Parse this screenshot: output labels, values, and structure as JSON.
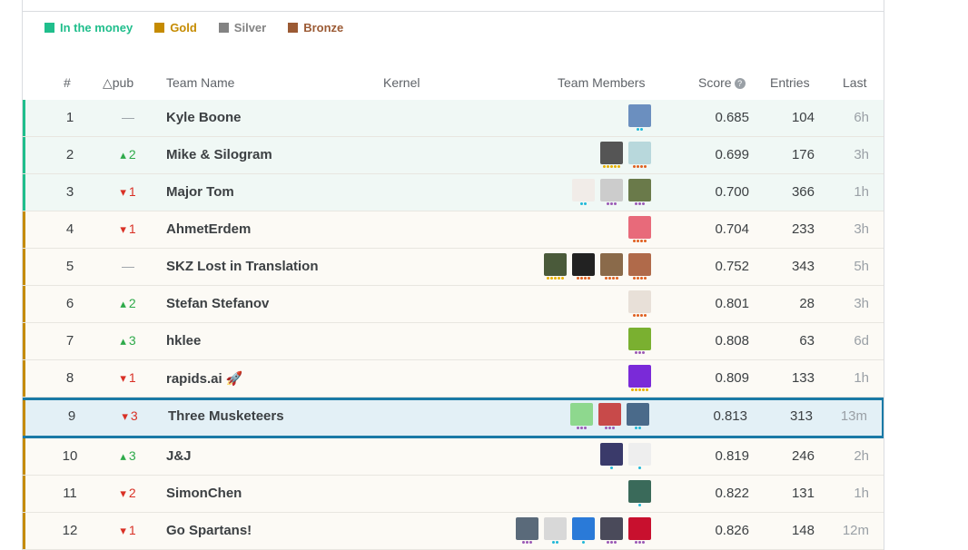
{
  "legend": [
    {
      "label": "In the money",
      "color": "#20be8c"
    },
    {
      "label": "Gold",
      "color": "#c58b00"
    },
    {
      "label": "Silver",
      "color": "#838383"
    },
    {
      "label": "Bronze",
      "color": "#9b5a34"
    }
  ],
  "columns": {
    "rank": "#",
    "delta": "△pub",
    "team": "Team Name",
    "kernel": "Kernel",
    "members": "Team Members",
    "score": "Score",
    "entries": "Entries",
    "last": "Last"
  },
  "rows": [
    {
      "rank": "1",
      "delta": "—",
      "team": "Kyle Boone",
      "score": "0.685",
      "entries": "104",
      "last": "6h",
      "tier": "money",
      "members": [
        {
          "color": "#6b8fbf",
          "dots": "#20b8d8",
          "n": 2
        }
      ]
    },
    {
      "rank": "2",
      "delta": "2",
      "dir": "up",
      "team": "Mike & Silogram",
      "score": "0.699",
      "entries": "176",
      "last": "3h",
      "tier": "money",
      "members": [
        {
          "color": "#555555",
          "dots": "#e8b000",
          "n": 5
        },
        {
          "color": "#b8d8dc",
          "dots": "#e06020",
          "n": 4
        }
      ]
    },
    {
      "rank": "3",
      "delta": "1",
      "dir": "down",
      "team": "Major Tom",
      "score": "0.700",
      "entries": "366",
      "last": "1h",
      "tier": "money",
      "members": [
        {
          "color": "#f1ece8",
          "dots": "#20b8d8",
          "n": 2
        },
        {
          "color": "#cccccc",
          "dots": "#9b59b6",
          "n": 3
        },
        {
          "color": "#6a7a4a",
          "dots": "#9b59b6",
          "n": 3
        }
      ]
    },
    {
      "rank": "4",
      "delta": "1",
      "dir": "down",
      "team": "AhmetErdem",
      "score": "0.704",
      "entries": "233",
      "last": "3h",
      "tier": "gold",
      "members": [
        {
          "color": "#e86a7a",
          "dots": "#e06020",
          "n": 4
        }
      ]
    },
    {
      "rank": "5",
      "delta": "—",
      "team": "SKZ Lost in Translation",
      "score": "0.752",
      "entries": "343",
      "last": "5h",
      "tier": "gold",
      "members": [
        {
          "color": "#4a5a3a",
          "dots": "#e8b000",
          "n": 5
        },
        {
          "color": "#222222",
          "dots": "#e06020",
          "n": 4
        },
        {
          "color": "#8a6a4a",
          "dots": "#e06020",
          "n": 4
        },
        {
          "color": "#b06a4a",
          "dots": "#e06020",
          "n": 4
        }
      ]
    },
    {
      "rank": "6",
      "delta": "2",
      "dir": "up",
      "team": "Stefan Stefanov",
      "score": "0.801",
      "entries": "28",
      "last": "3h",
      "tier": "gold",
      "members": [
        {
          "color": "#e8e0d8",
          "dots": "#e06020",
          "n": 4
        }
      ]
    },
    {
      "rank": "7",
      "delta": "3",
      "dir": "up",
      "team": "hklee",
      "score": "0.808",
      "entries": "63",
      "last": "6d",
      "tier": "gold",
      "members": [
        {
          "color": "#7ab030",
          "dots": "#9b59b6",
          "n": 3
        }
      ]
    },
    {
      "rank": "8",
      "delta": "1",
      "dir": "down",
      "team": "rapids.ai 🚀",
      "score": "0.809",
      "entries": "133",
      "last": "1h",
      "tier": "gold",
      "members": [
        {
          "color": "#7a2ad8",
          "dots": "#e8b000",
          "n": 5
        }
      ]
    },
    {
      "rank": "9",
      "delta": "3",
      "dir": "down",
      "team": "Three Musketeers",
      "score": "0.813",
      "entries": "313",
      "last": "13m",
      "tier": "gold",
      "selected": true,
      "members": [
        {
          "color": "#8ed88e",
          "dots": "#9b59b6",
          "n": 3
        },
        {
          "color": "#c84a4a",
          "dots": "#9b59b6",
          "n": 3
        },
        {
          "color": "#4a6a8a",
          "dots": "#20b8d8",
          "n": 2
        }
      ]
    },
    {
      "rank": "10",
      "delta": "3",
      "dir": "up",
      "team": "J&J",
      "score": "0.819",
      "entries": "246",
      "last": "2h",
      "tier": "gold",
      "members": [
        {
          "color": "#3a3a6a",
          "dots": "#20b8d8",
          "n": 1
        },
        {
          "color": "#eeeeee",
          "dots": "#20b8d8",
          "n": 1
        }
      ]
    },
    {
      "rank": "11",
      "delta": "2",
      "dir": "down",
      "team": "SimonChen",
      "score": "0.822",
      "entries": "131",
      "last": "1h",
      "tier": "gold",
      "members": [
        {
          "color": "#3a6a5a",
          "dots": "#20b8d8",
          "n": 1
        }
      ]
    },
    {
      "rank": "12",
      "delta": "1",
      "dir": "down",
      "team": "Go Spartans!",
      "score": "0.826",
      "entries": "148",
      "last": "12m",
      "tier": "gold",
      "members": [
        {
          "color": "#5a6a7a",
          "dots": "#9b59b6",
          "n": 3
        },
        {
          "color": "#d8d8d8",
          "dots": "#20b8d8",
          "n": 2
        },
        {
          "color": "#2a7ad8",
          "dots": "#20b8d8",
          "n": 1
        },
        {
          "color": "#4a4a5a",
          "dots": "#9b59b6",
          "n": 3
        },
        {
          "color": "#c8102e",
          "dots": "#9b59b6",
          "n": 3
        }
      ]
    }
  ],
  "colors": {
    "money_bg": "#f0f8f5",
    "gold_bg": "#fcfaf5",
    "selected_bg": "#e3f0f6",
    "up": "#2eaa4a",
    "down": "#d93025",
    "money_bar": "#20be8c",
    "gold_bar": "#c58b00"
  }
}
